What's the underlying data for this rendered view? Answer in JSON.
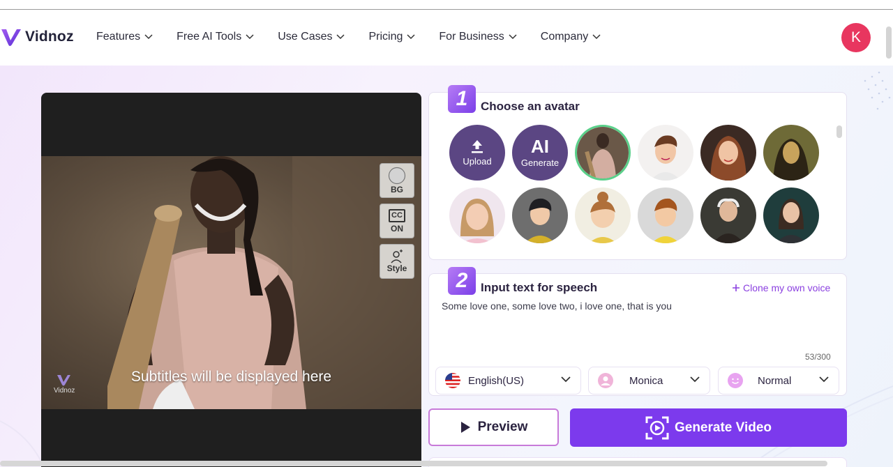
{
  "brand": {
    "name": "Vidnoz",
    "accent": "#7c3aed"
  },
  "nav": {
    "items": [
      {
        "label": "Features"
      },
      {
        "label": "Free AI Tools"
      },
      {
        "label": "Use Cases"
      },
      {
        "label": "Pricing"
      },
      {
        "label": "For Business"
      },
      {
        "label": "Company"
      }
    ],
    "user_initial": "K"
  },
  "preview": {
    "subtitle": "Subtitles will be displayed here",
    "watermark": "Vidnoz",
    "side_buttons": [
      {
        "label": "BG",
        "icon": "circle-bg-icon"
      },
      {
        "label": "ON",
        "icon": "closed-caption-icon",
        "badge": "CC"
      },
      {
        "label": "Style",
        "icon": "person-style-icon"
      }
    ]
  },
  "step1": {
    "number": "1",
    "title": "Choose an avatar",
    "upload_label": "Upload",
    "ai_label": "AI",
    "generate_label": "Generate"
  },
  "step2": {
    "number": "2",
    "title": "Input text for speech",
    "clone_label": "Clone my own voice",
    "text": "Some love one, some love two, i love one, that is you",
    "count": "53/300"
  },
  "selects": {
    "language": "English(US)",
    "voice": "Monica",
    "emotion": "Normal"
  },
  "actions": {
    "preview": "Preview",
    "generate": "Generate Video"
  }
}
